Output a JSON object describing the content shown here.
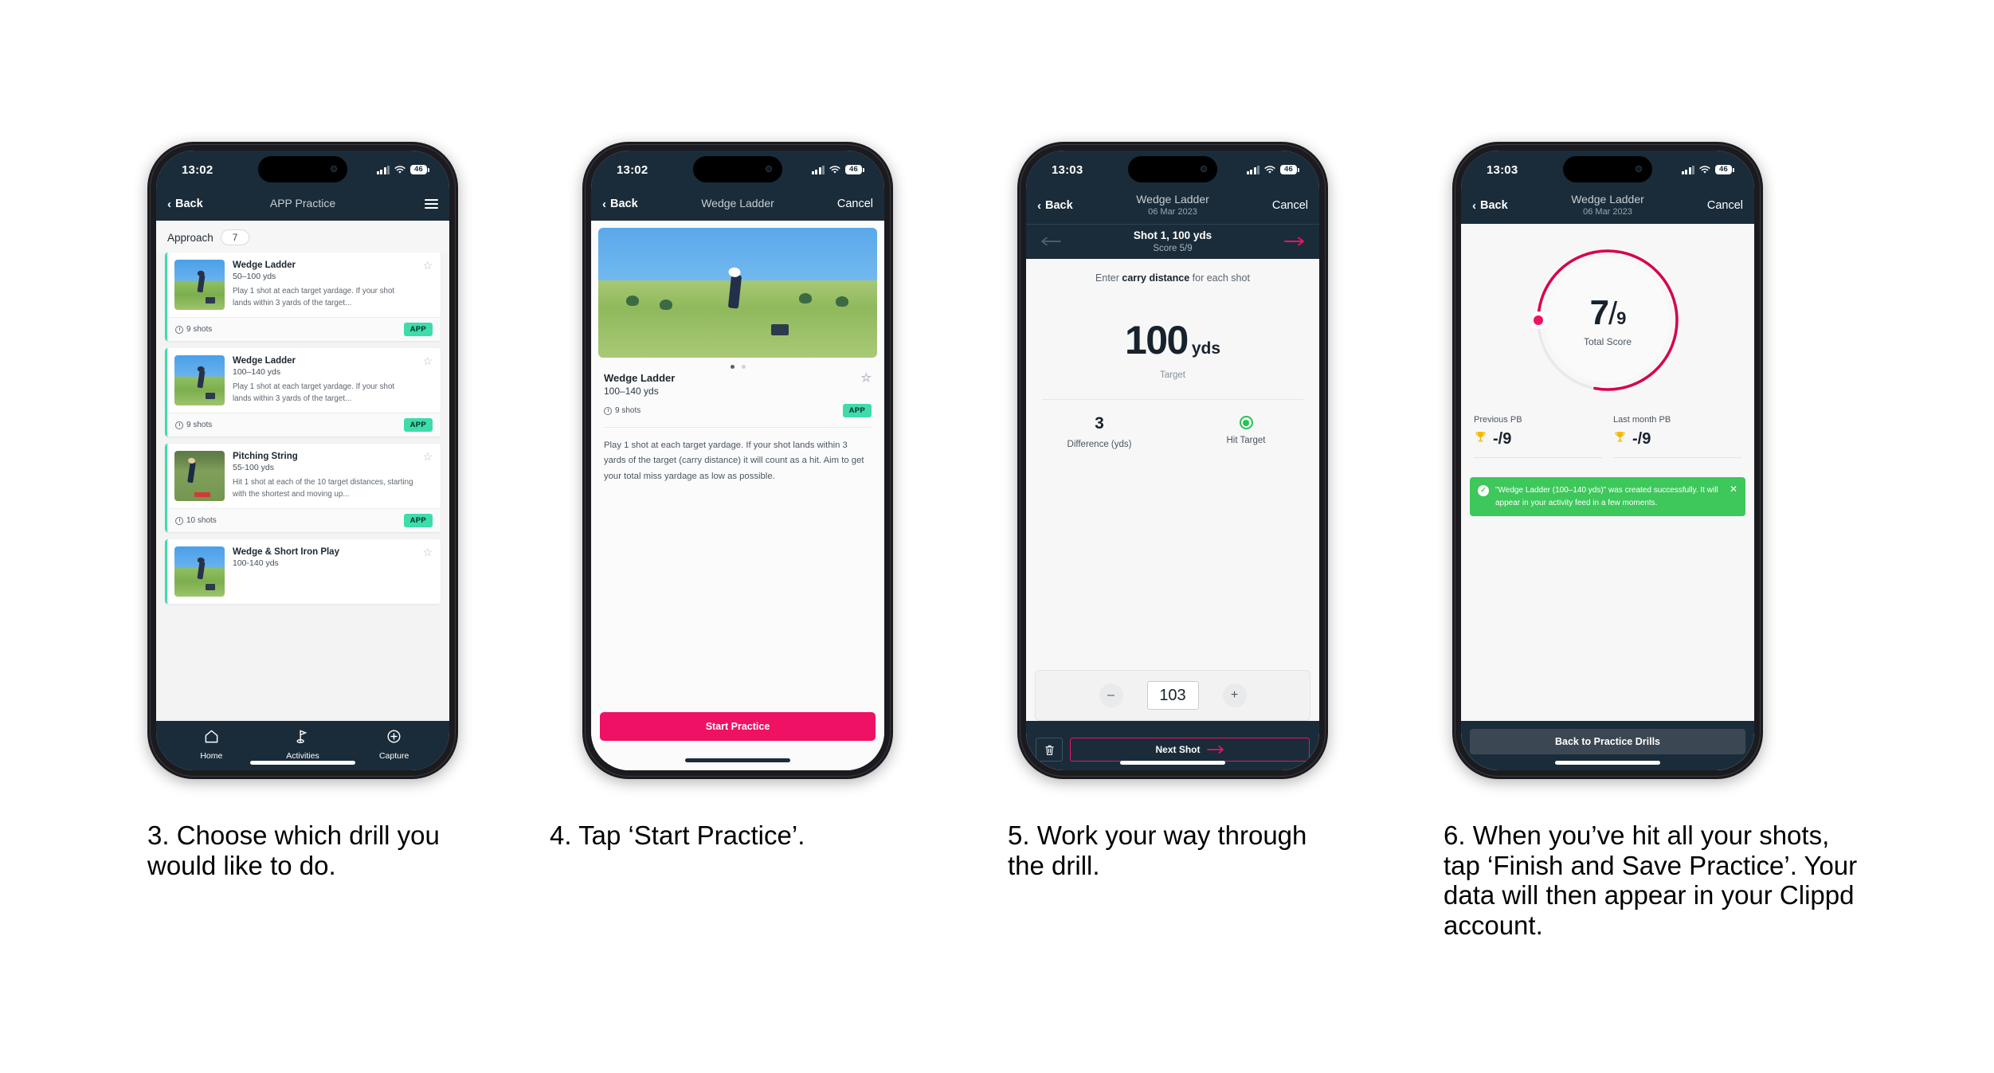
{
  "phones": [
    {
      "id": "phone-app-practice",
      "status": {
        "time": "13:02",
        "battery": "46"
      },
      "nav": {
        "back": "Back",
        "title": "APP Practice",
        "menu_icon": "hamburger-icon"
      },
      "filter": {
        "label": "Approach",
        "count": "7"
      },
      "drills": [
        {
          "title": "Wedge Ladder",
          "range": "50–100 yds",
          "desc": "Play 1 shot at each target yardage. If your shot lands within 3 yards of the target...",
          "shots": "9 shots",
          "badge": "APP"
        },
        {
          "title": "Wedge Ladder",
          "range": "100–140 yds",
          "desc": "Play 1 shot at each target yardage. If your shot lands within 3 yards of the target...",
          "shots": "9 shots",
          "badge": "APP"
        },
        {
          "title": "Pitching String",
          "range": "55-100 yds",
          "desc": "Hit 1 shot at each of the 10 target distances, starting with the shortest and moving up...",
          "shots": "10 shots",
          "badge": "APP"
        },
        {
          "title": "Wedge & Short Iron Play",
          "range": "100-140 yds",
          "desc": "",
          "shots": "",
          "badge": ""
        }
      ],
      "tabs": [
        {
          "label": "Home",
          "icon": "home-icon"
        },
        {
          "label": "Activities",
          "icon": "golf-flag-icon"
        },
        {
          "label": "Capture",
          "icon": "plus-circle-icon"
        }
      ]
    },
    {
      "id": "phone-drill-detail",
      "status": {
        "time": "13:02",
        "battery": "46"
      },
      "nav": {
        "back": "Back",
        "title": "Wedge Ladder",
        "right": "Cancel"
      },
      "detail": {
        "title": "Wedge Ladder",
        "range": "100–140 yds",
        "shots": "9 shots",
        "badge": "APP",
        "description": "Play 1 shot at each target yardage. If your shot lands within 3 yards of the target (carry distance) it will count as a hit. Aim to get your total miss yardage as low as possible."
      },
      "cta": "Start Practice"
    },
    {
      "id": "phone-shot-entry",
      "status": {
        "time": "13:03",
        "battery": "46"
      },
      "nav": {
        "back": "Back",
        "title": "Wedge Ladder",
        "subtitle": "06 Mar 2023",
        "right": "Cancel"
      },
      "shotbar": {
        "title": "Shot 1, 100 yds",
        "score": "Score 5/9"
      },
      "prompt_pre": "Enter ",
      "prompt_bold": "carry distance",
      "prompt_post": " for each shot",
      "target": {
        "value": "100",
        "unit": "yds",
        "label": "Target"
      },
      "stats": [
        {
          "value": "3",
          "label": "Difference (yds)"
        },
        {
          "value": "",
          "label": "Hit Target"
        }
      ],
      "stepper": {
        "minus": "–",
        "value": "103",
        "plus": "+"
      },
      "footer": {
        "delete_icon": "trash-icon",
        "next": "Next Shot"
      }
    },
    {
      "id": "phone-summary",
      "status": {
        "time": "13:03",
        "battery": "46"
      },
      "nav": {
        "back": "Back",
        "title": "Wedge Ladder",
        "subtitle": "06 Mar 2023",
        "right": "Cancel"
      },
      "gauge": {
        "score": "7",
        "slash": "/",
        "total": "9",
        "caption": "Total Score",
        "percent": 78,
        "color": "#d6004d"
      },
      "pbs": [
        {
          "label": "Previous PB",
          "value": "-/9",
          "icon": "trophy-icon"
        },
        {
          "label": "Last month PB",
          "value": "-/9",
          "icon": "trophy-icon"
        }
      ],
      "toast": {
        "text": "\"Wedge Ladder (100–140 yds)\" was created successfully. It will appear in your activity feed in a few moments.",
        "close": "✕",
        "color": "#3ec75b"
      },
      "footer_button": "Back to Practice Drills"
    }
  ],
  "captions": [
    "3. Choose which drill you would like to do.",
    "4. Tap ‘Start Practice’.",
    "5. Work your way through the drill.",
    "6. When you’ve hit all your shots, tap ‘Finish and Save Practice’. Your data will then appear in your Clippd account."
  ],
  "colors": {
    "nav_dark": "#1a2c3a",
    "accent_pink": "#ee1164",
    "accent_teal": "#3ddcaa",
    "toast_green": "#3ec75b",
    "hit_green": "#23c552"
  }
}
